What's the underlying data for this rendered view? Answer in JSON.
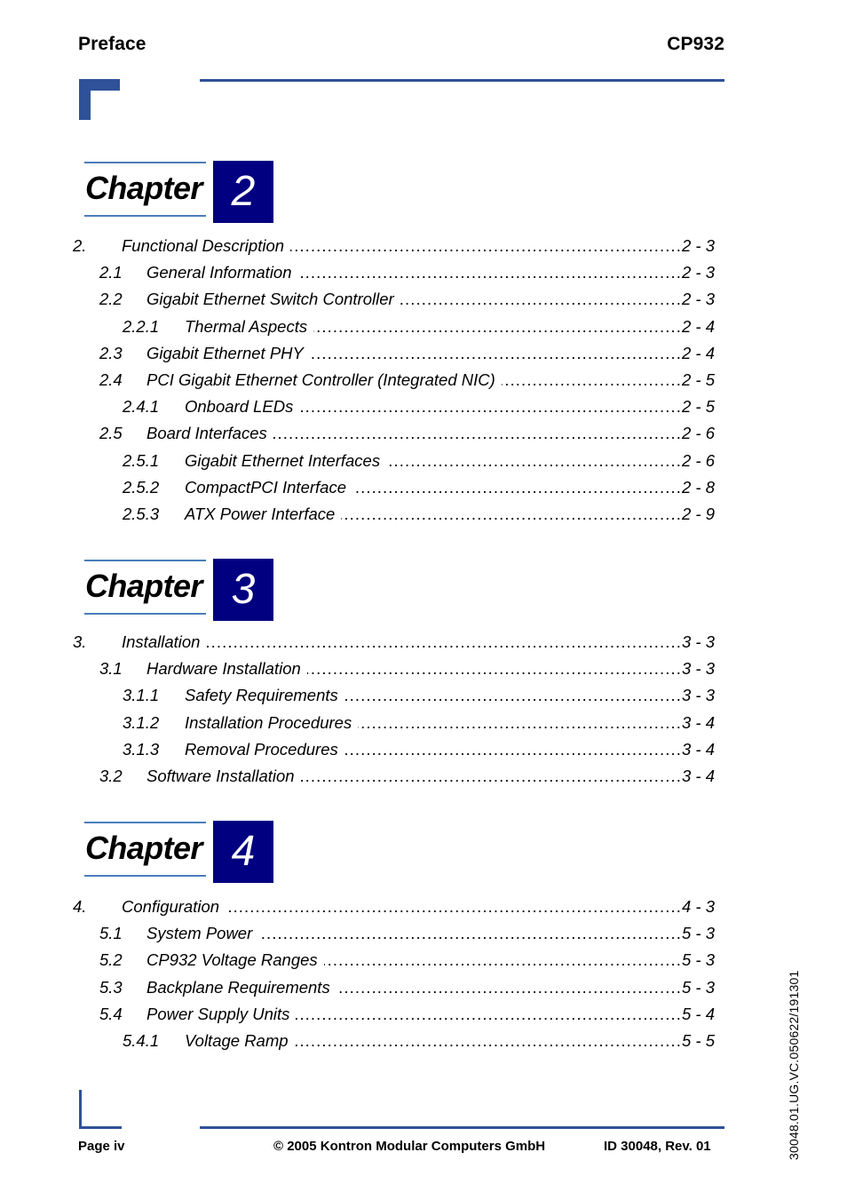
{
  "header": {
    "left_title": "Preface",
    "right_title": "CP932"
  },
  "chapters": [
    {
      "label": "Chapter",
      "number": "2",
      "entries": [
        {
          "level": 1,
          "num": "2.",
          "title": "Functional Description",
          "page": "2 - 3"
        },
        {
          "level": 2,
          "num": "2.1",
          "title": "General Information",
          "page": "2 - 3"
        },
        {
          "level": 2,
          "num": "2.2",
          "title": "Gigabit Ethernet Switch Controller",
          "page": "2 - 3"
        },
        {
          "level": 3,
          "num": "2.2.1",
          "title": "Thermal Aspects",
          "page": "2 - 4"
        },
        {
          "level": 2,
          "num": "2.3",
          "title": "Gigabit Ethernet PHY",
          "page": "2 - 4"
        },
        {
          "level": 2,
          "num": "2.4",
          "title": "PCI Gigabit Ethernet Controller (Integrated NIC)",
          "page": "2 - 5"
        },
        {
          "level": 3,
          "num": "2.4.1",
          "title": "Onboard LEDs",
          "page": "2 - 5"
        },
        {
          "level": 2,
          "num": "2.5",
          "title": "Board Interfaces",
          "page": "2 - 6"
        },
        {
          "level": 3,
          "num": "2.5.1",
          "title": "Gigabit Ethernet Interfaces",
          "page": "2 - 6"
        },
        {
          "level": 3,
          "num": "2.5.2",
          "title": "CompactPCI Interface",
          "page": "2 - 8"
        },
        {
          "level": 3,
          "num": "2.5.3",
          "title": "ATX Power Interface",
          "page": "2 - 9"
        }
      ]
    },
    {
      "label": "Chapter",
      "number": "3",
      "entries": [
        {
          "level": 1,
          "num": "3.",
          "title": "Installation",
          "page": "3 - 3"
        },
        {
          "level": 2,
          "num": "3.1",
          "title": "Hardware Installation",
          "page": "3 - 3"
        },
        {
          "level": 3,
          "num": "3.1.1",
          "title": "Safety Requirements",
          "page": "3 - 3"
        },
        {
          "level": 3,
          "num": "3.1.2",
          "title": "Installation Procedures",
          "page": "3 - 4"
        },
        {
          "level": 3,
          "num": "3.1.3",
          "title": "Removal Procedures",
          "page": "3 - 4"
        },
        {
          "level": 2,
          "num": "3.2",
          "title": "Software Installation",
          "page": "3 - 4"
        }
      ]
    },
    {
      "label": "Chapter",
      "number": "4",
      "entries": [
        {
          "level": 1,
          "num": "4.",
          "title": "Configuration",
          "page": "4 - 3"
        },
        {
          "level": 2,
          "num": "5.1",
          "title": "System Power",
          "page": "5 - 3"
        },
        {
          "level": 2,
          "num": "5.2",
          "title": "CP932 Voltage Ranges",
          "page": "5 - 3"
        },
        {
          "level": 2,
          "num": "5.3",
          "title": "Backplane Requirements",
          "page": "5 - 3"
        },
        {
          "level": 2,
          "num": "5.4",
          "title": "Power Supply Units",
          "page": "5 - 4"
        },
        {
          "level": 3,
          "num": "5.4.1",
          "title": "Voltage Ramp",
          "page": "5 - 5"
        }
      ]
    }
  ],
  "footer": {
    "page_label": "Page iv",
    "copyright": "© 2005 Kontron Modular Computers GmbH",
    "document_id": "ID 30048, Rev. 01"
  },
  "side_id": "30048.01.UG.VC.050622/191301",
  "colors": {
    "rule_blue": "#2e5199",
    "chapter_line_blue": "#4a7ebb",
    "chapter_box_navy": "#000080"
  }
}
